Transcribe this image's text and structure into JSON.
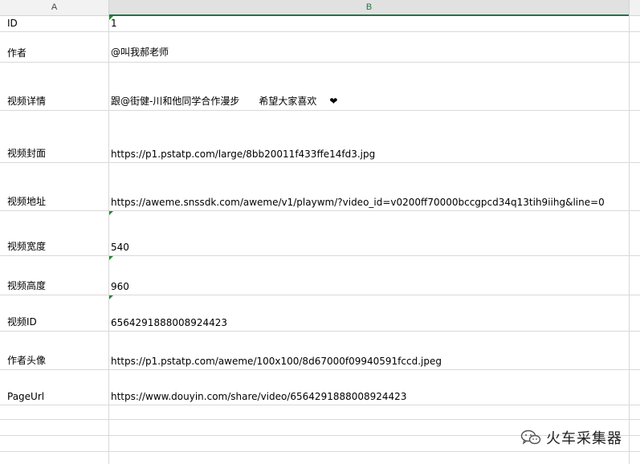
{
  "columns": {
    "a": "A",
    "b": "B"
  },
  "rows": [
    {
      "label": "ID",
      "value": "1"
    },
    {
      "label": "作者",
      "value": "@叫我郝老师"
    },
    {
      "label": "视频详情",
      "value": "跟@街健-川和他同学合作漫步　　希望大家喜欢　",
      "emoji": "❤"
    },
    {
      "label": "视频封面",
      "value": "https://p1.pstatp.com/large/8bb20011f433ffe14fd3.jpg"
    },
    {
      "label": "视频地址",
      "value": "https://aweme.snssdk.com/aweme/v1/playwm/?video_id=v0200ff70000bccgpcd34q13tih9iihg&line=0"
    },
    {
      "label": "视频宽度",
      "value": "540"
    },
    {
      "label": "视频高度",
      "value": "960"
    },
    {
      "label": "视频ID",
      "value": "6564291888008924423"
    },
    {
      "label": "作者头像",
      "value": "https://p1.pstatp.com/aweme/100x100/8d67000f09940591fccd.jpeg"
    },
    {
      "label": "PageUrl",
      "value": "https://www.douyin.com/share/video/6564291888008924423"
    }
  ],
  "watermark": {
    "text": "火车采集器",
    "icon": "wechat-icon"
  },
  "colors": {
    "accent": "#217346",
    "grid": "#d9d9d9",
    "marker": "#1f8a2a"
  }
}
